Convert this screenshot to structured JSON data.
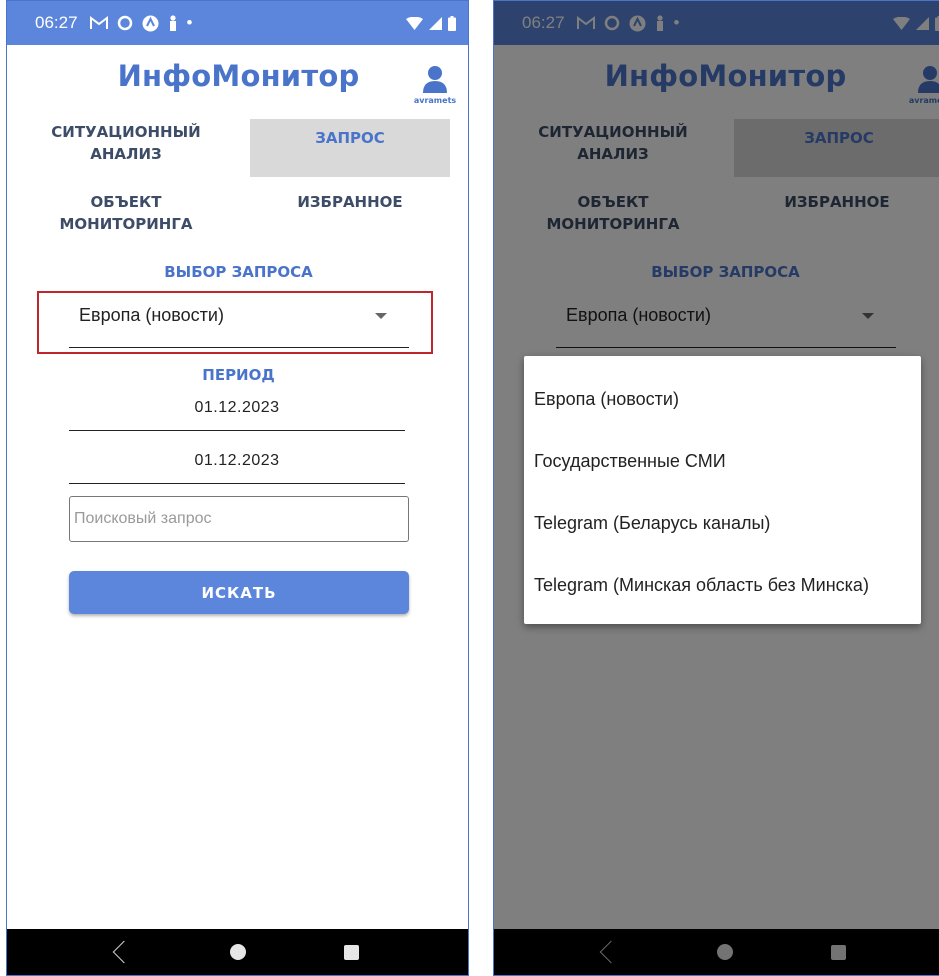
{
  "status_bar": {
    "time": "06:27"
  },
  "app": {
    "title": "ИнфоМонитор",
    "username": "avramets"
  },
  "tabs": [
    {
      "label": "СИТУАЦИОННЫЙ АНАЛИЗ",
      "active": false
    },
    {
      "label": "ЗАПРОС",
      "active": true
    },
    {
      "label": "ОБЪЕКТ МОНИТОРИНГА",
      "active": false
    },
    {
      "label": "ИЗБРАННОЕ",
      "active": false
    }
  ],
  "query": {
    "section_label": "ВЫБОР ЗАПРОСА",
    "selected": "Европа (новости)",
    "options": [
      "Европа (новости)",
      "Государственные СМИ",
      "Telegram (Беларусь каналы)",
      "Telegram (Минская область без Минска)"
    ]
  },
  "period": {
    "label": "ПЕРИОД",
    "date_from": "01.12.2023",
    "date_to": "01.12.2023"
  },
  "search": {
    "placeholder": "Поисковый запрос",
    "value": "",
    "button_label": "ИСКАТЬ"
  },
  "colors": {
    "accent": "#4a74c9",
    "status_bar": "#5b86dc",
    "highlight": "#c0272d",
    "active_tab_bg": "#d9d9d9"
  },
  "icons": [
    "gmail-icon",
    "circle-app-icon",
    "arrow-badge-icon",
    "person-stand-icon",
    "wifi-icon",
    "signal-icon",
    "battery-icon",
    "user-icon",
    "back-icon",
    "home-icon",
    "recents-icon"
  ]
}
